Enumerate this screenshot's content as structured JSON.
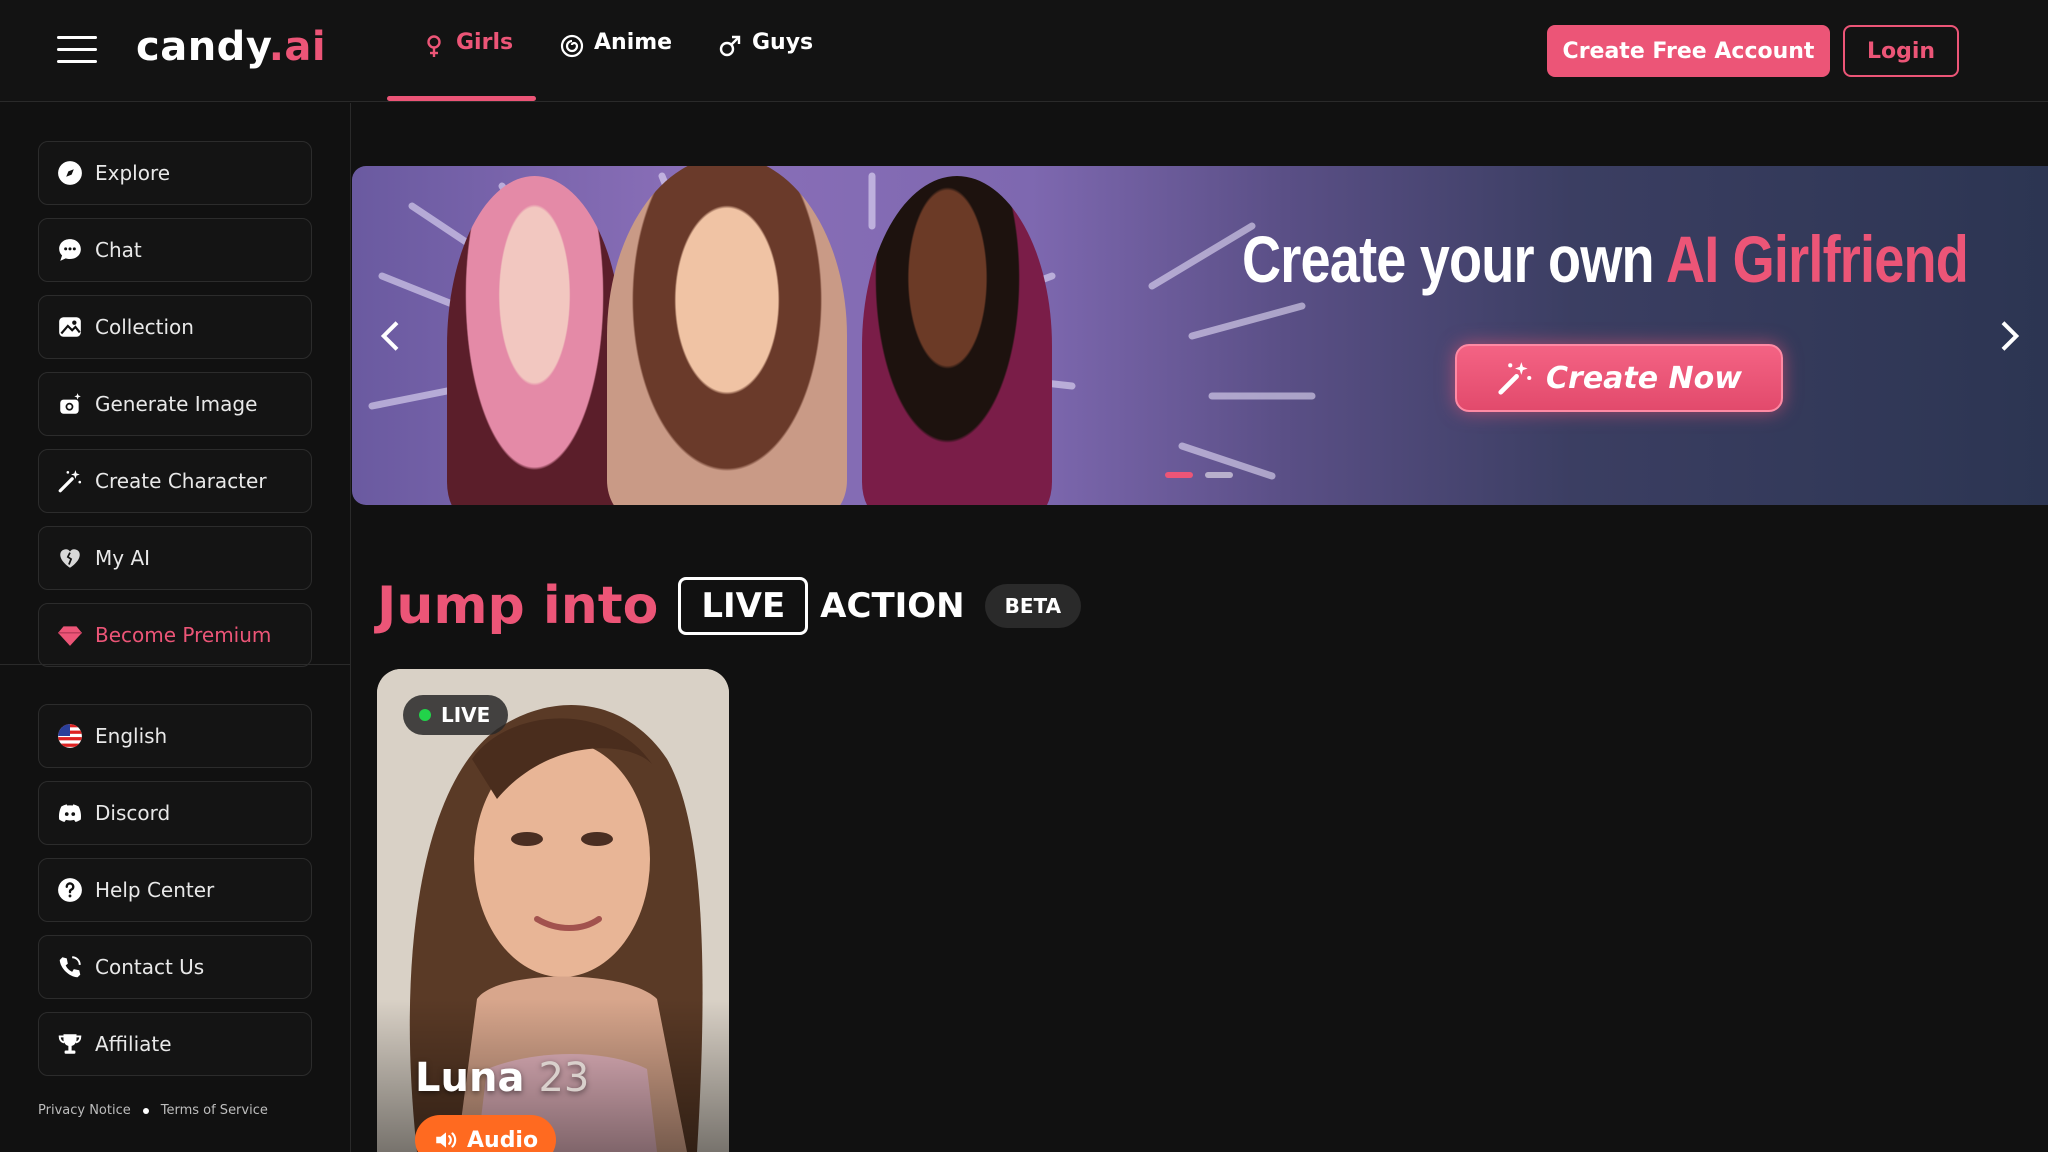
{
  "header": {
    "logo_main": "candy",
    "logo_suffix": ".ai",
    "tabs": [
      {
        "label": "Girls",
        "icon": "female-icon",
        "active": true
      },
      {
        "label": "Anime",
        "icon": "anime-swirl-icon",
        "active": false
      },
      {
        "label": "Guys",
        "icon": "male-icon",
        "active": false
      }
    ],
    "create_account_label": "Create Free Account",
    "login_label": "Login"
  },
  "sidebar": {
    "items": [
      {
        "label": "Explore",
        "icon": "compass-icon"
      },
      {
        "label": "Chat",
        "icon": "chat-bubble-icon"
      },
      {
        "label": "Collection",
        "icon": "image-gallery-icon"
      },
      {
        "label": "Generate Image",
        "icon": "camera-sparkle-icon"
      },
      {
        "label": "Create Character",
        "icon": "magic-wand-icon"
      },
      {
        "label": "My AI",
        "icon": "heart-icon"
      },
      {
        "label": "Become Premium",
        "icon": "diamond-icon"
      }
    ],
    "secondary": [
      {
        "label": "English",
        "icon": "us-flag-icon"
      },
      {
        "label": "Discord",
        "icon": "discord-icon"
      },
      {
        "label": "Help Center",
        "icon": "help-circle-icon"
      },
      {
        "label": "Contact Us",
        "icon": "contact-phone-icon"
      },
      {
        "label": "Affiliate",
        "icon": "trophy-icon"
      }
    ],
    "footer": {
      "privacy": "Privacy Notice",
      "terms": "Terms of Service"
    }
  },
  "banner": {
    "title_white": "Create your own",
    "title_accent": "AI Girlfriend",
    "cta_label": "Create Now",
    "slides_total": 2,
    "slide_active": 1
  },
  "live_section": {
    "heading_pink": "Jump into",
    "heading_live": "LIVE",
    "heading_action": "ACTION",
    "badge": "BETA"
  },
  "card": {
    "live_label": "LIVE",
    "name": "Luna",
    "age": "23",
    "audio_label": "Audio"
  },
  "colors": {
    "accent": "#ec5577",
    "background": "#111111",
    "live_dot": "#22d34a",
    "audio": "#ff6a20"
  }
}
